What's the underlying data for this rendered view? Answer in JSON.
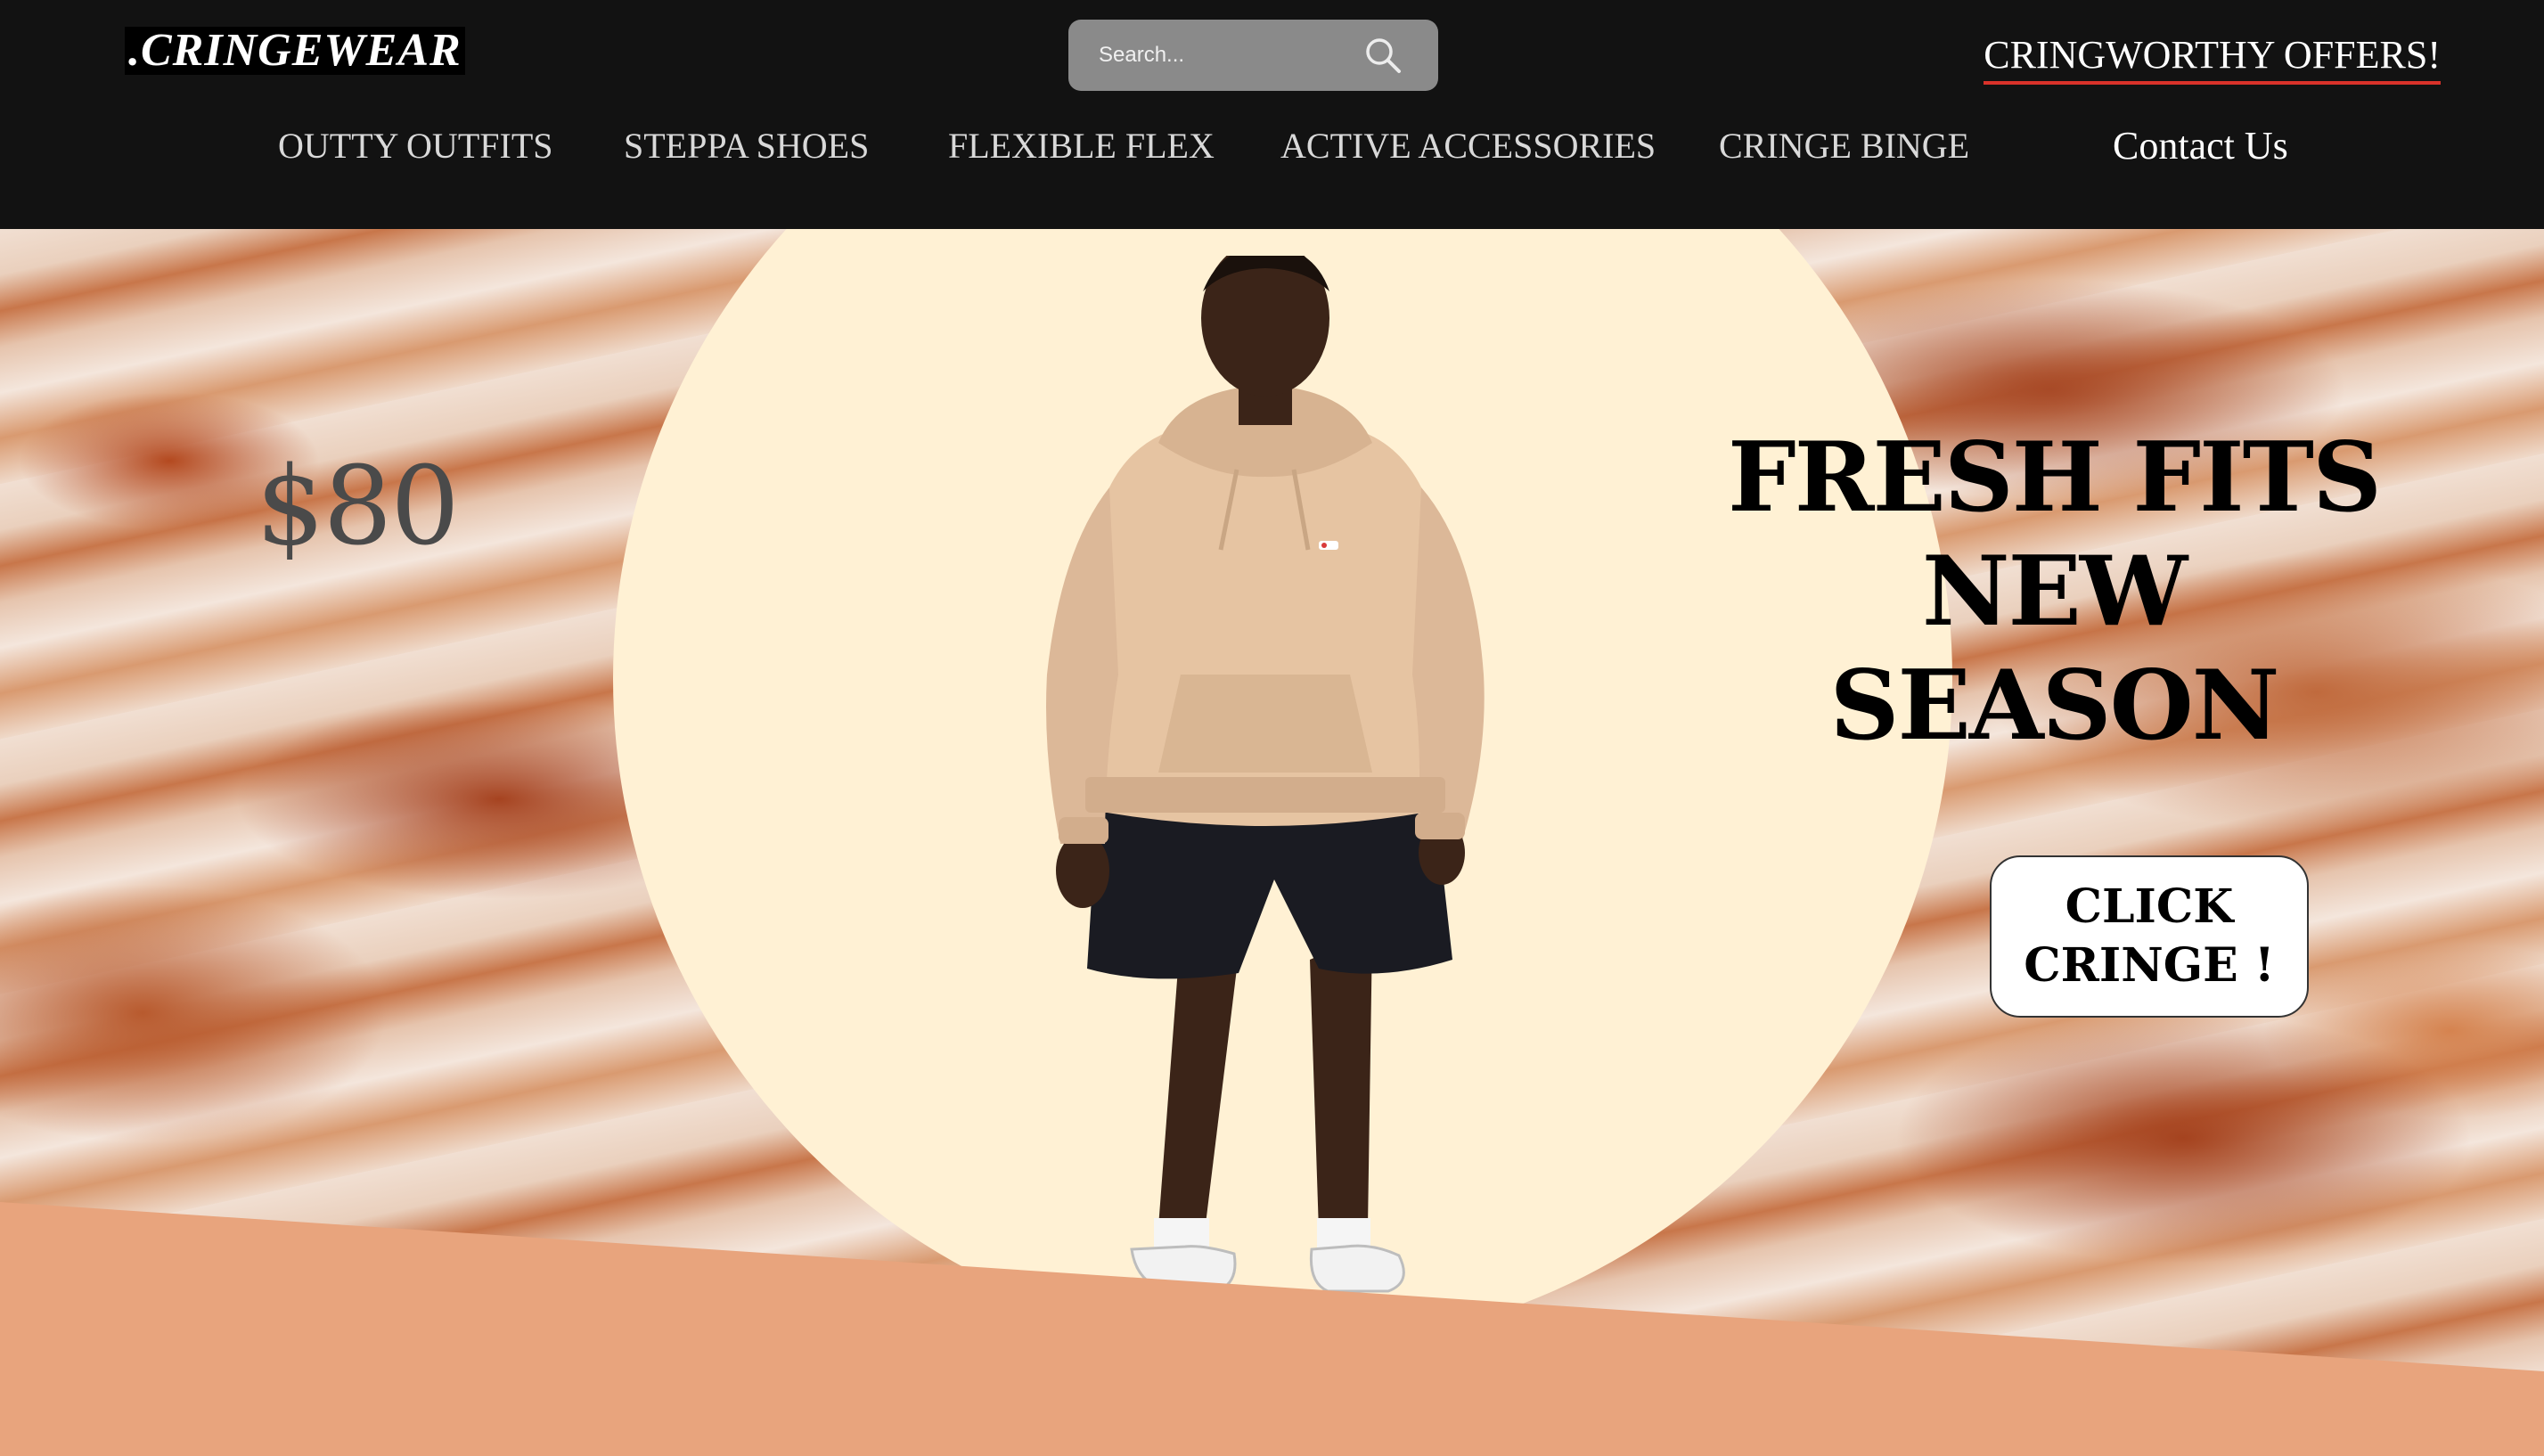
{
  "header": {
    "logo": ".CRINGEWEAR",
    "search": {
      "placeholder": "Search..."
    },
    "offers_link": "CRINGWORTHY OFFERS!",
    "nav": [
      "OUTTY OUTFITS",
      "STEPPA SHOES",
      "FLEXIBLE FLEX",
      "ACTIVE ACCESSORIES",
      "CRINGE BINGE",
      "Contact Us"
    ]
  },
  "hero": {
    "price": "$80",
    "headline": [
      "FRESH FITS",
      "NEW",
      "SEASON"
    ],
    "cta": "CLICK CRINGE !"
  },
  "colors": {
    "header_bg": "#121212",
    "circle_bg": "#fff1d4",
    "wedge": "#e8a47d",
    "offers_underline": "#d9322a"
  },
  "icons": [
    "search-icon"
  ]
}
